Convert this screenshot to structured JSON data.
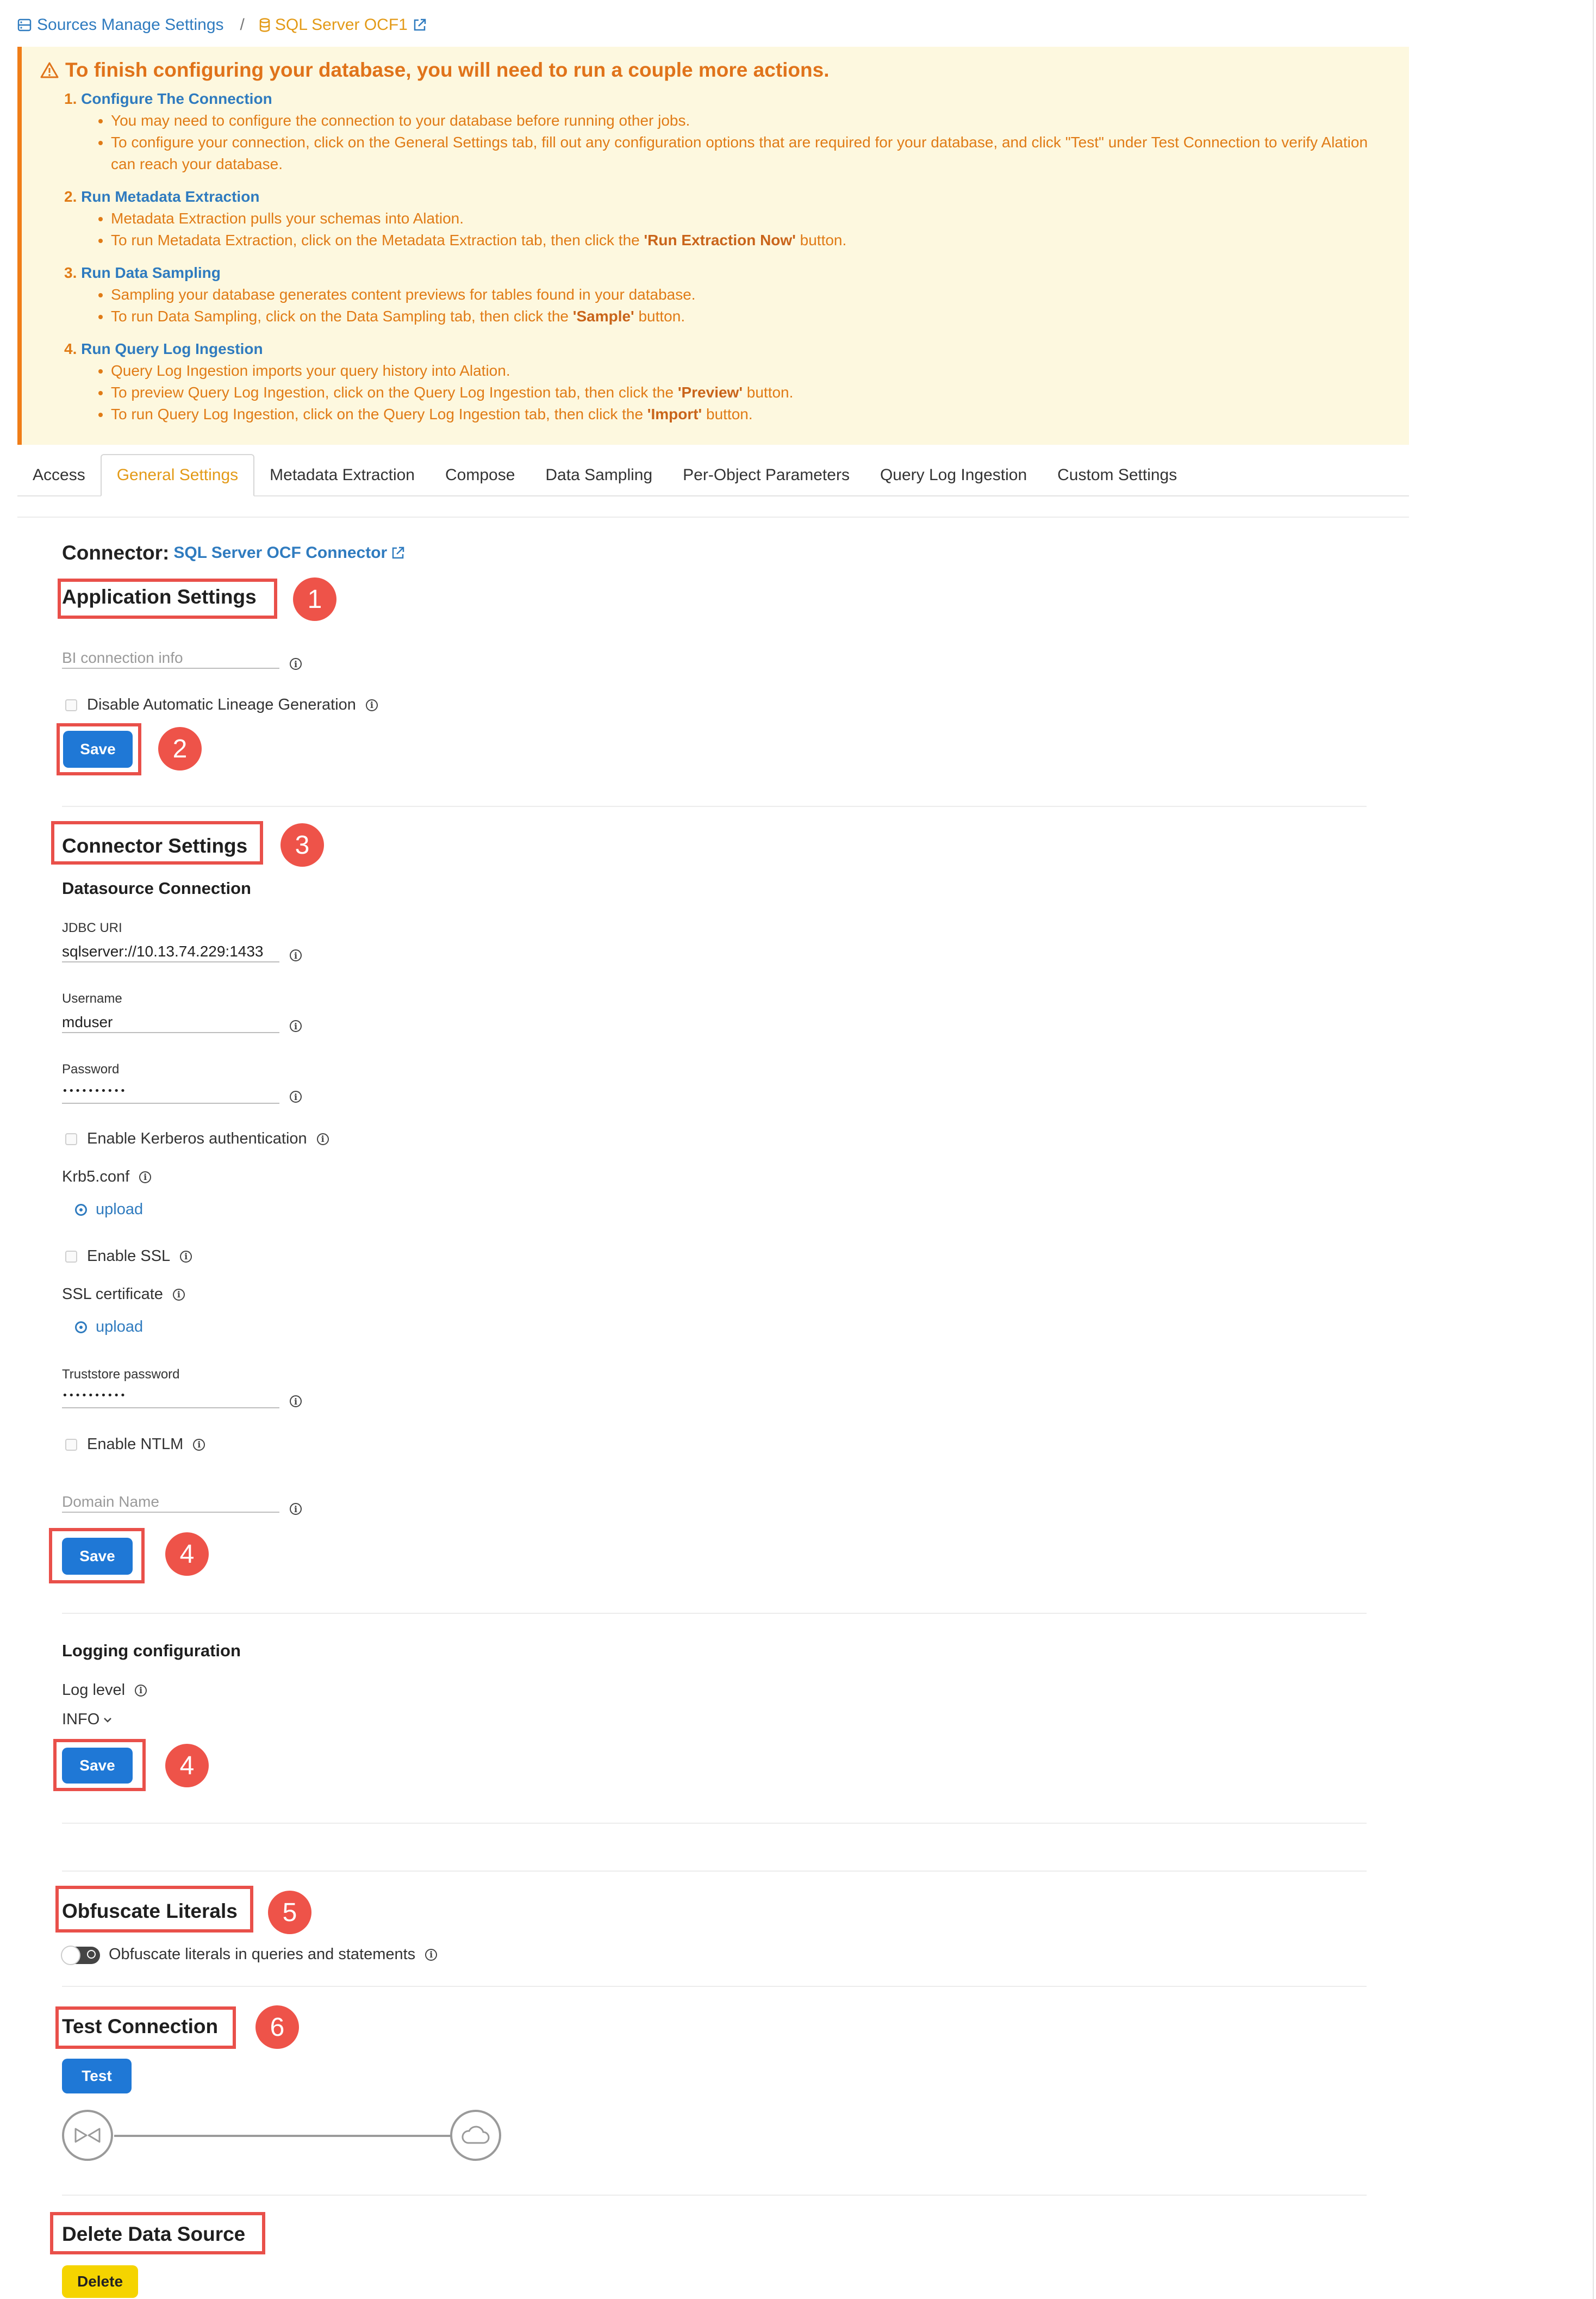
{
  "breadcrumb": {
    "parent": "Sources Manage Settings",
    "separator": "/",
    "current": "SQL Server OCF1"
  },
  "alert": {
    "title": "To finish configuring your database, you will need to run a couple more actions.",
    "steps": [
      {
        "num": "1.",
        "title": "Configure The Connection",
        "bullets": [
          "You may need to configure the connection to your database before running other jobs.",
          "To configure your connection, click on the General Settings tab, fill out any configuration options that are required for your database, and click \"Test\" under Test Connection to verify Alation can reach your database."
        ]
      },
      {
        "num": "2.",
        "title": "Run Metadata Extraction",
        "bullets": [
          "Metadata Extraction pulls your schemas into Alation.",
          "To run Metadata Extraction, click on the Metadata Extraction tab, then click the 'Run Extraction Now' button."
        ]
      },
      {
        "num": "3.",
        "title": "Run Data Sampling",
        "bullets": [
          "Sampling your database generates content previews for tables found in your database.",
          "To run Data Sampling, click on the Data Sampling tab, then click the 'Sample' button."
        ]
      },
      {
        "num": "4.",
        "title": "Run Query Log Ingestion",
        "bullets": [
          "Query Log Ingestion imports your query history into Alation.",
          "To preview Query Log Ingestion, click on the Query Log Ingestion tab, then click the 'Preview' button.",
          "To run Query Log Ingestion, click on the Query Log Ingestion tab, then click the 'Import' button."
        ]
      }
    ]
  },
  "tabs": [
    {
      "label": "Access"
    },
    {
      "label": "General Settings"
    },
    {
      "label": "Metadata Extraction"
    },
    {
      "label": "Compose"
    },
    {
      "label": "Data Sampling"
    },
    {
      "label": "Per-Object Parameters"
    },
    {
      "label": "Query Log Ingestion"
    },
    {
      "label": "Custom Settings"
    }
  ],
  "connector": {
    "label": "Connector:",
    "link": "SQL Server OCF Connector"
  },
  "app_settings": {
    "title": "Application Settings",
    "bi_placeholder": "BI connection info",
    "disable_lineage": "Disable Automatic Lineage Generation",
    "save": "Save"
  },
  "connector_settings": {
    "title": "Connector Settings",
    "datasource_title": "Datasource Connection",
    "jdbc_label": "JDBC URI",
    "jdbc_value": "sqlserver://10.13.74.229:1433",
    "username_label": "Username",
    "username_value": "mduser",
    "password_label": "Password",
    "password_value": "••••••••••",
    "kerberos": "Enable Kerberos authentication",
    "krb5_label": "Krb5.conf",
    "upload": "upload",
    "ssl": "Enable SSL",
    "ssl_cert_label": "SSL certificate",
    "truststore_label": "Truststore password",
    "truststore_value": "••••••••••",
    "ntlm": "Enable NTLM",
    "domain_placeholder": "Domain Name",
    "save": "Save"
  },
  "logging": {
    "title": "Logging configuration",
    "level_label": "Log level",
    "level_value": "INFO",
    "save": "Save"
  },
  "obfuscate": {
    "title": "Obfuscate Literals",
    "toggle_label": "Obfuscate literals in queries and statements"
  },
  "test_connection": {
    "title": "Test Connection",
    "button": "Test"
  },
  "delete_source": {
    "title": "Delete Data Source",
    "button": "Delete"
  },
  "annotations": {
    "b1": "1",
    "b2": "2",
    "b3": "3",
    "b4a": "4",
    "b4b": "4",
    "b5": "5",
    "b6": "6"
  },
  "colors": {
    "accent_blue": "#1f78d6",
    "link_blue": "#2f7bbf",
    "warning_orange": "#e07b16",
    "annotation_red": "#e9504a",
    "delete_yellow": "#f5d400"
  }
}
